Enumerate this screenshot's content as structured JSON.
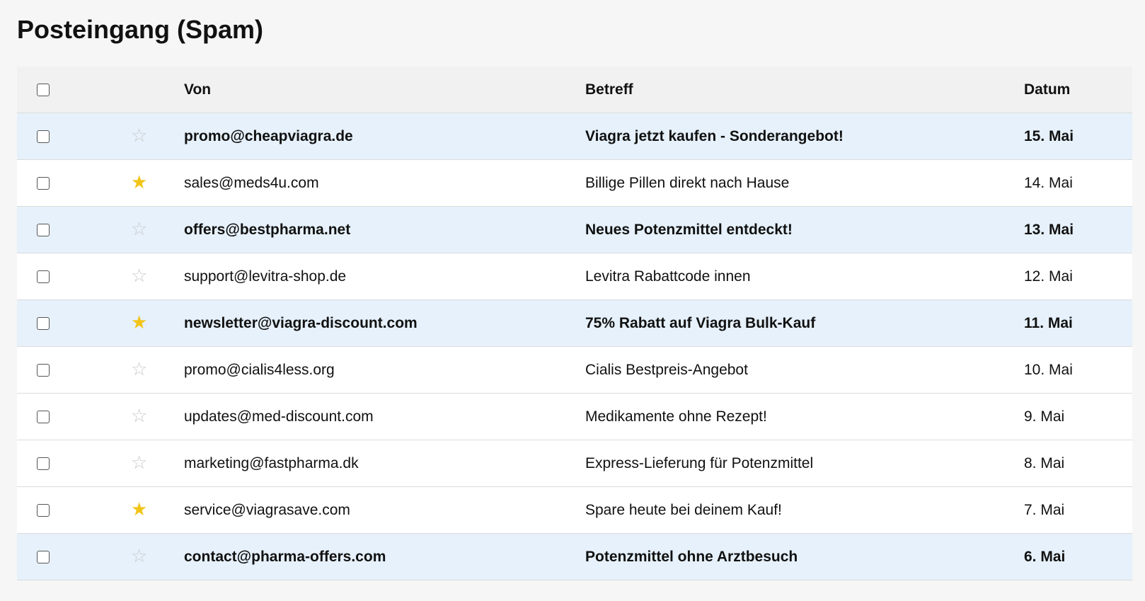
{
  "title": "Posteingang (Spam)",
  "columns": {
    "from": "Von",
    "subject": "Betreff",
    "date": "Datum"
  },
  "colors": {
    "unread_row": "#e6f1fb",
    "read_row": "#ffffff",
    "header": "#f1f1f1",
    "star_on": "#f2c417",
    "star_off": "#c9c9c9"
  },
  "emails": [
    {
      "from": "promo@cheapviagra.de",
      "subject": "Viagra jetzt kaufen - Sonderangebot!",
      "date": "15. Mai",
      "unread": true,
      "starred": false,
      "star_icon": "star-outline-icon"
    },
    {
      "from": "sales@meds4u.com",
      "subject": "Billige Pillen direkt nach Hause",
      "date": "14. Mai",
      "unread": false,
      "starred": true,
      "star_icon": "star-filled-icon"
    },
    {
      "from": "offers@bestpharma.net",
      "subject": "Neues Potenzmittel entdeckt!",
      "date": "13. Mai",
      "unread": true,
      "starred": false,
      "star_icon": "star-outline-icon"
    },
    {
      "from": "support@levitra-shop.de",
      "subject": "Levitra Rabattcode innen",
      "date": "12. Mai",
      "unread": false,
      "starred": false,
      "star_icon": "star-outline-icon"
    },
    {
      "from": "newsletter@viagra-discount.com",
      "subject": "75% Rabatt auf Viagra Bulk-Kauf",
      "date": "11. Mai",
      "unread": true,
      "starred": true,
      "star_icon": "star-filled-icon"
    },
    {
      "from": "promo@cialis4less.org",
      "subject": "Cialis Bestpreis-Angebot",
      "date": "10. Mai",
      "unread": false,
      "starred": false,
      "star_icon": "star-outline-icon"
    },
    {
      "from": "updates@med-discount.com",
      "subject": "Medikamente ohne Rezept!",
      "date": "9. Mai",
      "unread": false,
      "starred": false,
      "star_icon": "star-outline-icon"
    },
    {
      "from": "marketing@fastpharma.dk",
      "subject": "Express-Lieferung für Potenzmittel",
      "date": "8. Mai",
      "unread": false,
      "starred": false,
      "star_icon": "star-outline-icon"
    },
    {
      "from": "service@viagrasave.com",
      "subject": "Spare heute bei deinem Kauf!",
      "date": "7. Mai",
      "unread": false,
      "starred": true,
      "star_icon": "star-filled-icon"
    },
    {
      "from": "contact@pharma-offers.com",
      "subject": "Potenzmittel ohne Arztbesuch",
      "date": "6. Mai",
      "unread": true,
      "starred": false,
      "star_icon": "star-outline-icon"
    }
  ]
}
